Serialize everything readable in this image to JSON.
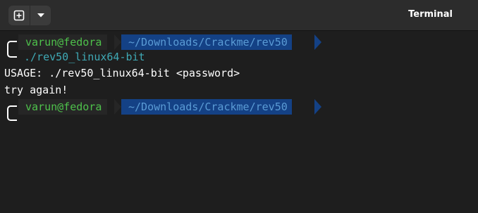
{
  "window": {
    "title": "Terminal"
  },
  "header": {
    "new_tab_icon": "plus-square-icon",
    "menu_icon": "chevron-down-icon"
  },
  "terminal": {
    "prompts": [
      {
        "user_host": "varun@fedora",
        "path": "~/Downloads/Crackme/rev50"
      },
      {
        "user_host": "varun@fedora",
        "path": "~/Downloads/Crackme/rev50"
      }
    ],
    "command": "./rev50_linux64-bit",
    "output": [
      "USAGE: ./rev50_linux64-bit <password>",
      "try again!"
    ]
  },
  "colors": {
    "background": "#1e1e1e",
    "header": "#2c2c2c",
    "user_host": "#4ec14b",
    "path_bg": "#144185",
    "path_fg": "#5a9bd5",
    "command": "#3fa9b5"
  }
}
